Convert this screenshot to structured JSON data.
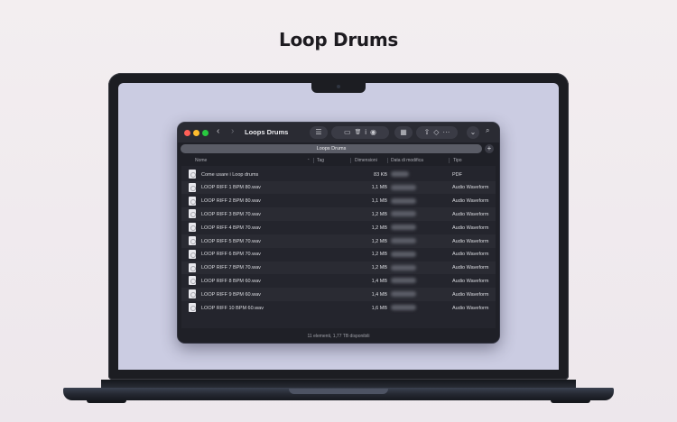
{
  "page": {
    "title": "Loop Drums"
  },
  "window": {
    "title": "Loops Drums",
    "tab_label": "Loops Drums",
    "tab_add": "+",
    "status": "11 elementi, 1,77 TB disponibili"
  },
  "toolbar": {
    "back": "‹",
    "forward": "›",
    "view_list": "☰",
    "new_folder": "▭",
    "trash": "🗑",
    "info": "i",
    "preview": "◉",
    "grid": "▦",
    "share": "⇧",
    "tag": "◇",
    "more": "···",
    "chevron": "⌄",
    "search": "⌕"
  },
  "columns": {
    "name": "Nome",
    "tag": "Tag",
    "size": "Dimensioni",
    "date": "Data di modifica",
    "kind": "Tipo"
  },
  "files": [
    {
      "name": "Come usare i Loop drums",
      "size": "83 KB",
      "kind": "PDF"
    },
    {
      "name": "LOOP RIFF 1 BPM 80.wav",
      "size": "1,1 MB",
      "kind": "Audio Waveform"
    },
    {
      "name": "LOOP RIFF 2 BPM 80.wav",
      "size": "1,1 MB",
      "kind": "Audio Waveform"
    },
    {
      "name": "LOOP RIFF 3 BPM 70.wav",
      "size": "1,2 MB",
      "kind": "Audio Waveform"
    },
    {
      "name": "LOOP RIFF 4 BPM 70.wav",
      "size": "1,2 MB",
      "kind": "Audio Waveform"
    },
    {
      "name": "LOOP RIFF 5 BPM 70.wav",
      "size": "1,2 MB",
      "kind": "Audio Waveform"
    },
    {
      "name": "LOOP RIFF 6 BPM 70.wav",
      "size": "1,2 MB",
      "kind": "Audio Waveform"
    },
    {
      "name": "LOOP RIFF 7 BPM 70.wav",
      "size": "1,2 MB",
      "kind": "Audio Waveform"
    },
    {
      "name": "LOOP RIFF 8 BPM 60.wav",
      "size": "1,4 MB",
      "kind": "Audio Waveform"
    },
    {
      "name": "LOOP RIFF 9 BPM 60.wav",
      "size": "1,4 MB",
      "kind": "Audio Waveform"
    },
    {
      "name": "LOOP RIFF 10 BPM 60.wav",
      "size": "1,6 MB",
      "kind": "Audio Waveform"
    }
  ],
  "colors": {
    "background": "#f0ebee",
    "screen": "#cbcce2",
    "window": "#1f2027",
    "close": "#fe5f57",
    "minimize": "#febc2e",
    "zoom": "#28c840"
  }
}
